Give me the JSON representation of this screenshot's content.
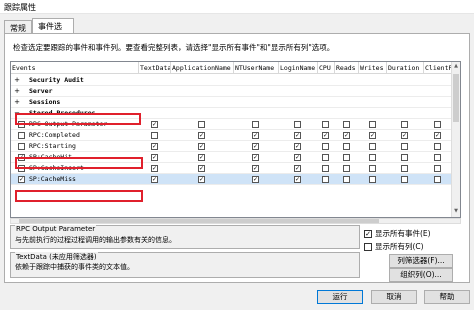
{
  "window": {
    "title": "跟踪属性"
  },
  "tabs": [
    "常规",
    "事件选择"
  ],
  "description": "检查选定要跟踪的事件和事件列。要查看完整列表，请选择\"显示所有事件\"和\"显示所有列\"选项。",
  "grid": {
    "columns": [
      "Events",
      "TextData",
      "ApplicationName",
      "NTUserName",
      "LoginName",
      "CPU",
      "Reads",
      "Writes",
      "Duration",
      "ClientP"
    ],
    "rows": [
      {
        "type": "category",
        "expander": "+",
        "label": "Security Audit"
      },
      {
        "type": "category",
        "expander": "+",
        "label": "Server"
      },
      {
        "type": "category",
        "expander": "+",
        "label": "Sessions"
      },
      {
        "type": "category",
        "expander": "−",
        "label": "Stored Procedures"
      },
      {
        "type": "event",
        "checked": false,
        "label": "RPC Output Parameter",
        "cells": [
          true,
          false,
          false,
          false,
          false,
          false,
          false,
          false,
          false
        ]
      },
      {
        "type": "event",
        "checked": false,
        "label": "RPC:Completed",
        "cells": [
          false,
          true,
          true,
          true,
          true,
          true,
          true,
          true,
          true
        ]
      },
      {
        "type": "event",
        "checked": false,
        "label": "RPC:Starting",
        "cells": [
          true,
          true,
          true,
          true,
          false,
          false,
          false,
          false,
          false
        ]
      },
      {
        "type": "event",
        "checked": true,
        "label": "SP:CacheHit",
        "cells": [
          true,
          true,
          true,
          true,
          false,
          false,
          false,
          false,
          false
        ]
      },
      {
        "type": "event",
        "checked": false,
        "label": "SP:CacheInsert",
        "cells": [
          true,
          true,
          true,
          true,
          false,
          false,
          false,
          false,
          false
        ]
      },
      {
        "type": "event",
        "checked": true,
        "label": "SP:CacheMiss",
        "cells": [
          true,
          true,
          true,
          true,
          false,
          false,
          false,
          false,
          false
        ],
        "selected": true
      }
    ],
    "check_glyph": "✓"
  },
  "group1": {
    "title": "RPC Output Parameter",
    "text": "与先前执行的过程过程调用的输出参数有关的信息。"
  },
  "group2": {
    "title": "TextData (未应用筛选器)",
    "text": "依赖于跟踪中捕获的事件类的文本值。"
  },
  "options": {
    "show_all_events": {
      "label": "显示所有事件(E)",
      "checked": true
    },
    "show_all_columns": {
      "label": "显示所有列(C)",
      "checked": false
    }
  },
  "buttons": {
    "column_filters": "列筛选器(F)...",
    "organize_columns": "组织列(O)...",
    "run": "运行",
    "cancel": "取消",
    "help": "帮助"
  },
  "colors": {
    "highlight_box": "#e0202c",
    "selection": "#cfe3f7"
  }
}
